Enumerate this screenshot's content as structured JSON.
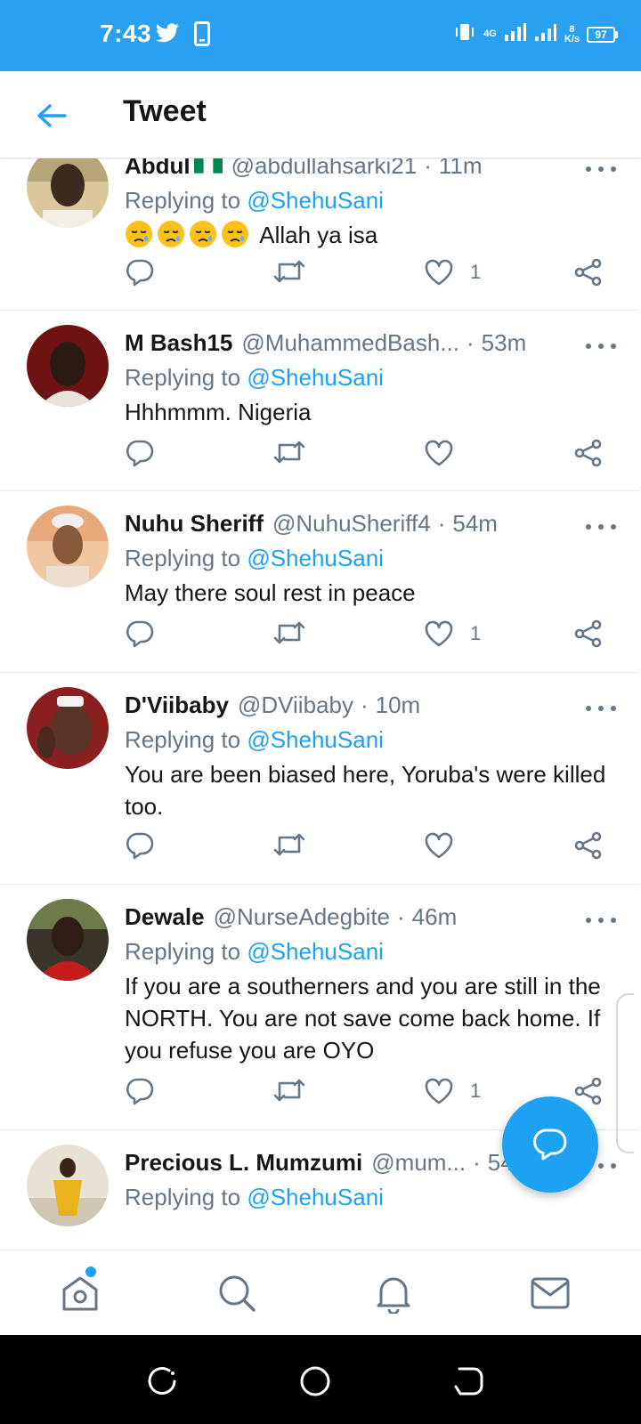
{
  "status_bar": {
    "time": "7:43",
    "network_top": "4G",
    "speed_value": "8",
    "speed_unit": "K/s",
    "battery": "97"
  },
  "header": {
    "title": "Tweet"
  },
  "replying_prefix": "Replying to",
  "tweets": [
    {
      "name": "Abdul",
      "handle": "@abdullahsarki21",
      "time": "11m",
      "replying_to": "@ShehuSani",
      "text": "Allah ya isa",
      "likes": "1"
    },
    {
      "name": "M Bash15",
      "handle": "@MuhammedBash...",
      "time": "53m",
      "replying_to": "@ShehuSani",
      "text": "Hhhmmm. Nigeria",
      "likes": ""
    },
    {
      "name": "Nuhu Sheriff",
      "handle": "@NuhuSheriff4",
      "time": "54m",
      "replying_to": "@ShehuSani",
      "text": "May there soul rest in peace",
      "likes": "1"
    },
    {
      "name": "D'Viibaby",
      "handle": "@DViibaby",
      "time": "10m",
      "replying_to": "@ShehuSani",
      "text": "You are been biased here, Yoruba's were killed too.",
      "likes": ""
    },
    {
      "name": "Dewale",
      "handle": "@NurseAdegbite",
      "time": "46m",
      "replying_to": "@ShehuSani",
      "text": "If you are a southerners and you are still in the NORTH. You are not save come back home. If you refuse you are OYO",
      "likes": "1"
    },
    {
      "name": "Precious L. Mumzumi",
      "handle": "@mum...",
      "time": "54",
      "replying_to": "@ShehuSani",
      "text": "",
      "likes": ""
    }
  ],
  "icons": {
    "back": "arrow-left-icon",
    "more": "more-horizontal-icon",
    "reply": "comment-icon",
    "retweet": "retweet-icon",
    "like": "heart-icon",
    "share": "share-icon",
    "compose": "compose-reply-icon",
    "home": "home-icon",
    "search": "search-icon",
    "notifications": "bell-icon",
    "messages": "mail-icon"
  },
  "colors": {
    "status_bar": "#2aa1f0",
    "accent": "#1da1f2",
    "text": "#14171a",
    "muted": "#657786"
  }
}
